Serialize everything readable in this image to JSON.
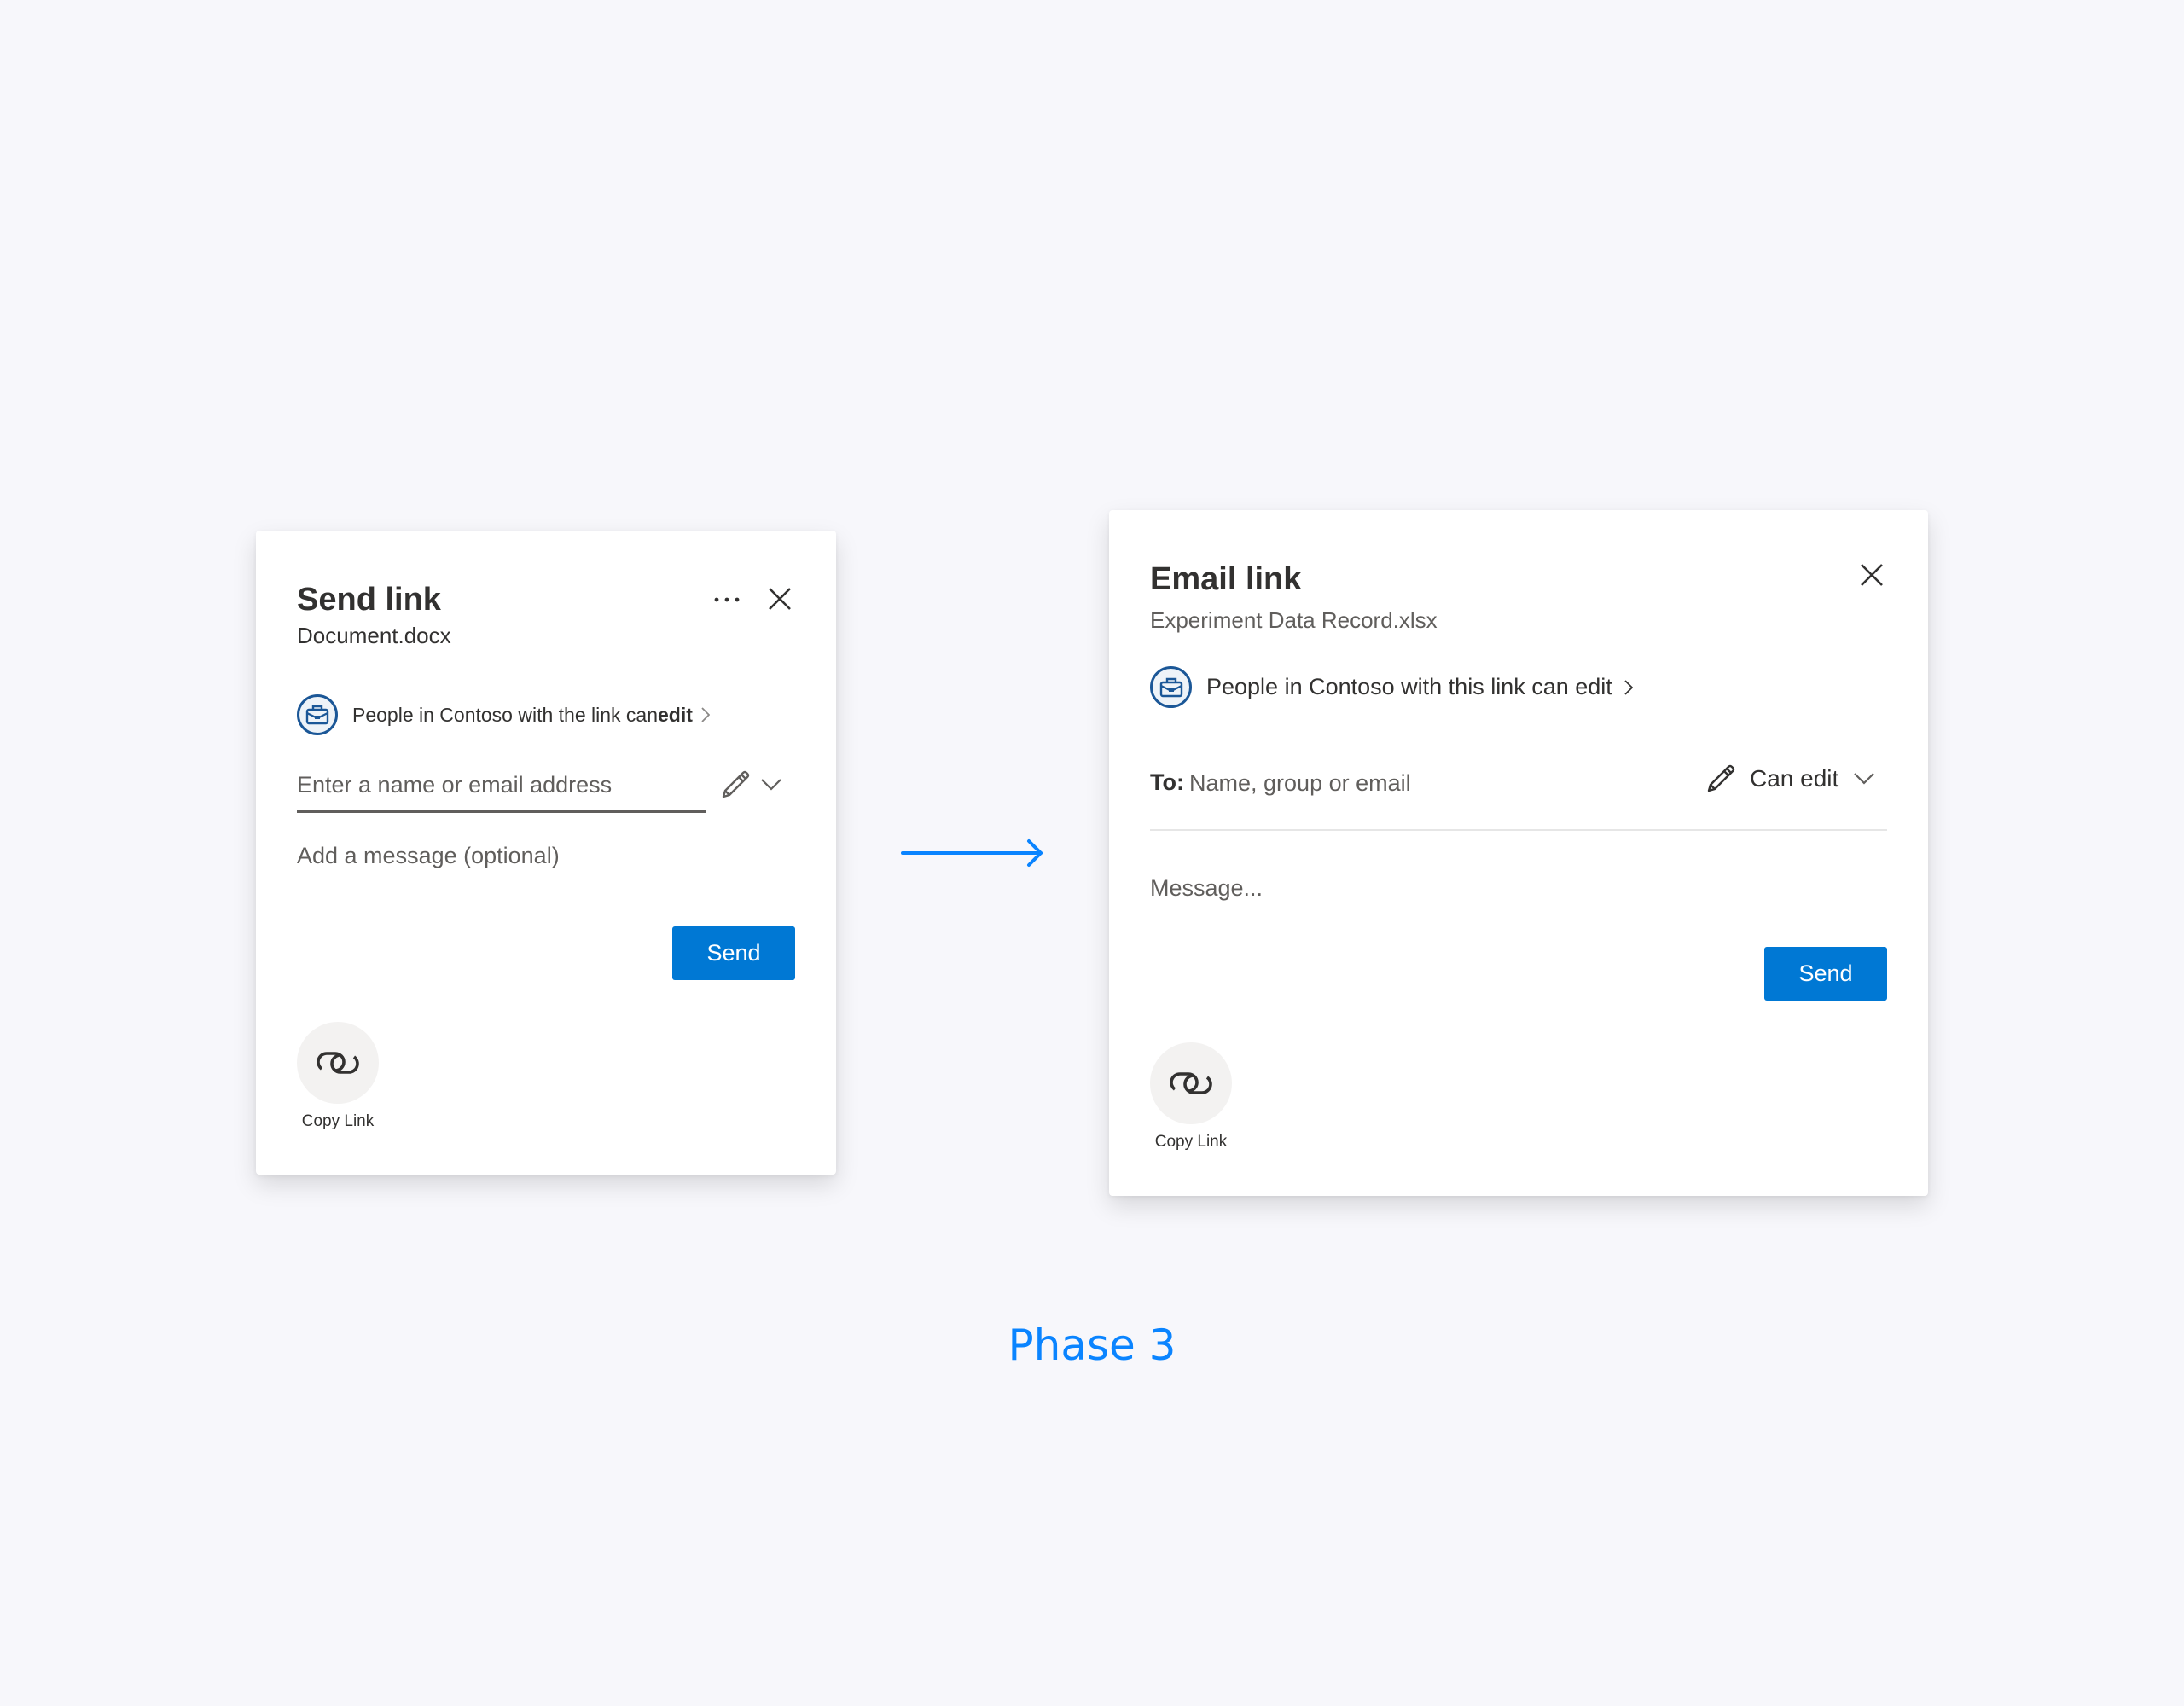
{
  "colors": {
    "background": "#f7f7fb",
    "primary_button": "#0078d4",
    "accent_arrow": "#0a84ff",
    "phase_label": "#0a84ff",
    "org_icon_stroke": "#1b5797",
    "copy_link_circle": "#f3f2f1"
  },
  "send_link_dialog": {
    "title": "Send link",
    "file_name": "Document.docx",
    "more_options_icon": "ellipsis-icon",
    "close_icon": "close-icon",
    "permission": {
      "icon": "briefcase-icon",
      "text_prefix": "People in Contoso with the link can ",
      "text_emphasis": "edit",
      "chevron_icon": "chevron-right-icon"
    },
    "recipient_input": {
      "placeholder": "Enter a name or email address",
      "value": ""
    },
    "permission_picker": {
      "edit_icon": "pencil-icon",
      "dropdown_icon": "chevron-down-icon"
    },
    "message_input": {
      "placeholder": "Add a message (optional)",
      "value": ""
    },
    "send_label": "Send",
    "copy_link": {
      "icon": "link-icon",
      "label": "Copy Link"
    }
  },
  "transition_arrow_icon": "arrow-right-icon",
  "email_link_dialog": {
    "title": "Email link",
    "file_name": "Experiment Data Record.xlsx",
    "close_icon": "close-icon",
    "permission": {
      "icon": "briefcase-icon",
      "text": "People in Contoso with this link can edit",
      "chevron_icon": "chevron-right-icon"
    },
    "to_label": "To:",
    "recipient_input": {
      "placeholder": "Name, group or email",
      "value": ""
    },
    "permission_picker": {
      "edit_icon": "pencil-icon",
      "label": "Can edit",
      "dropdown_icon": "chevron-down-icon"
    },
    "message_input": {
      "placeholder": "Message...",
      "value": ""
    },
    "send_label": "Send",
    "copy_link": {
      "icon": "link-icon",
      "label": "Copy Link"
    }
  },
  "phase_label": "Phase 3"
}
